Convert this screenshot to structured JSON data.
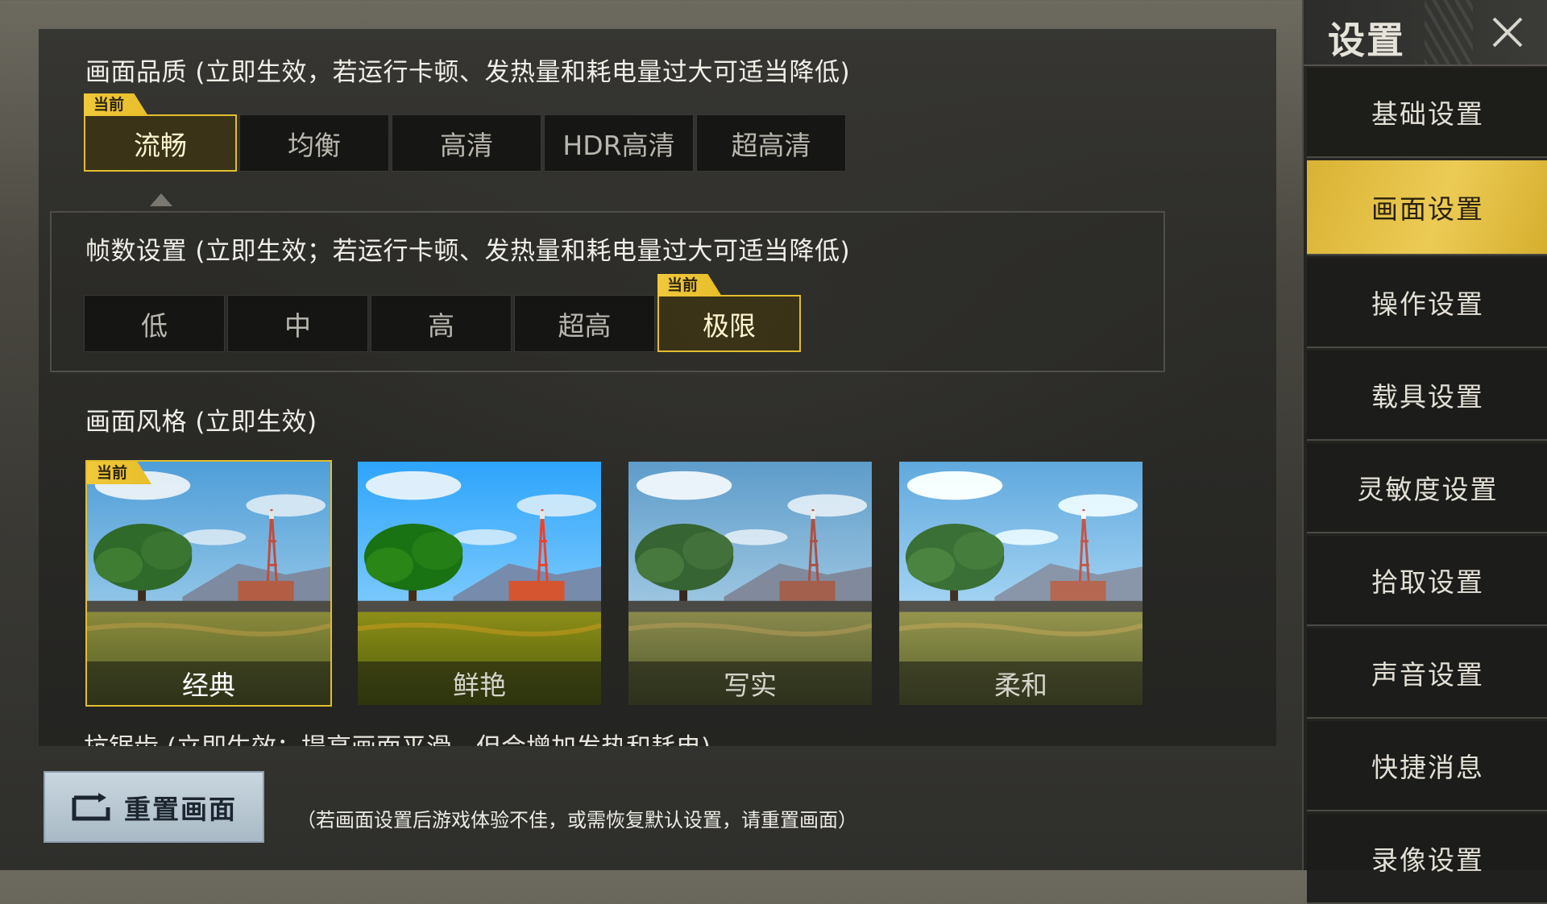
{
  "quality": {
    "title": "画面品质 (立即生效，若运行卡顿、发热量和耗电量过大可适当降低)",
    "tag": "当前",
    "options": [
      "流畅",
      "均衡",
      "高清",
      "HDR高清",
      "超高清"
    ],
    "selected": "流畅"
  },
  "fps": {
    "title": "帧数设置 (立即生效；若运行卡顿、发热量和耗电量过大可适当降低)",
    "tag": "当前",
    "options": [
      "低",
      "中",
      "高",
      "超高",
      "极限"
    ],
    "selected": "极限"
  },
  "style": {
    "title": "画面风格 (立即生效)",
    "tag": "当前",
    "options": [
      "经典",
      "鲜艳",
      "写实",
      "柔和"
    ],
    "selected": "经典"
  },
  "antialias": {
    "title": "抗锯齿 (立即生效：提高画面平滑，但会增加发热和耗电)"
  },
  "reset": {
    "label": "重置画面",
    "hint": "（若画面设置后游戏体验不佳，或需恢复默认设置，请重置画面）"
  },
  "sidebar": {
    "title": "设置",
    "items": [
      {
        "label": "基础设置"
      },
      {
        "label": "画面设置"
      },
      {
        "label": "操作设置"
      },
      {
        "label": "载具设置"
      },
      {
        "label": "灵敏度设置"
      },
      {
        "label": "拾取设置"
      },
      {
        "label": "声音设置"
      },
      {
        "label": "快捷消息"
      },
      {
        "label": "录像设置"
      }
    ],
    "selected": "画面设置"
  },
  "colors": {
    "accent": "#e2bd2e",
    "sidebar_active": "#e0bb3e",
    "reset_button": "#b7c6d0"
  },
  "icons": {
    "close": "close-icon",
    "reset": "reset-frame-icon"
  }
}
